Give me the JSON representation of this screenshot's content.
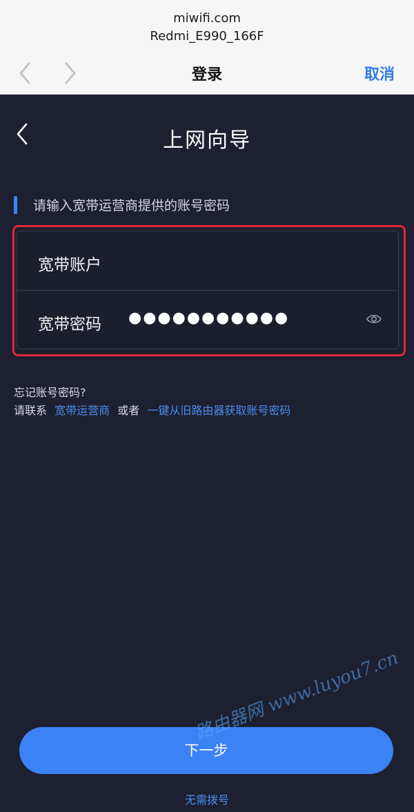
{
  "browser": {
    "host": "miwifi.com",
    "ssid": "Redmi_E990_166F",
    "title": "登录",
    "cancel_label": "取消"
  },
  "page": {
    "title": "上网向导",
    "section_label": "请输入宽带运营商提供的账号密码"
  },
  "form": {
    "account_label": "宽带账户",
    "password_label": "宽带密码",
    "password_value": "●●●●●●●●●●●"
  },
  "help": {
    "forgot": "忘记账号密码?",
    "prefix": "请联系",
    "isp_link": "宽带运营商",
    "or": "或者",
    "old_router_link": "一键从旧路由器获取账号密码"
  },
  "actions": {
    "next_label": "下一步",
    "no_dial_label": "无需拨号"
  },
  "watermark": "路由器网 www.luyou7.cn",
  "colors": {
    "accent": "#3b82f4",
    "link": "#4a8ef0",
    "highlight": "#e22638",
    "background": "#1d2030"
  }
}
